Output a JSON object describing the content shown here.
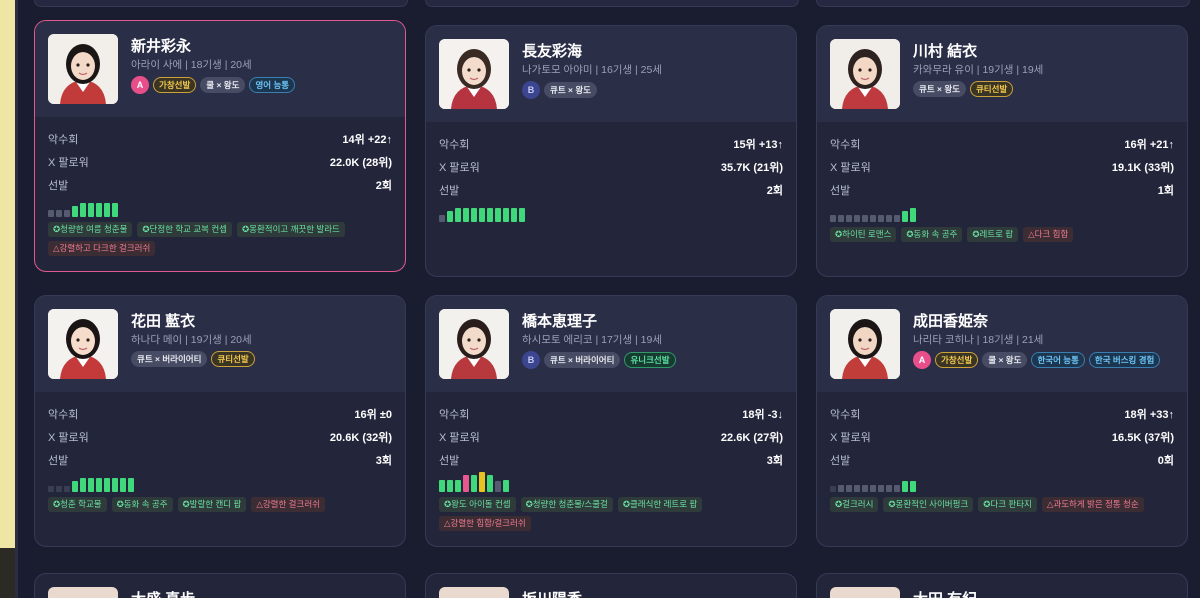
{
  "cards": [
    {
      "name": "新井彩永",
      "sub": "아라이 사에 | 18기생 | 20세",
      "team": "A",
      "tags": [
        {
          "label": "가창선발",
          "style": "gold"
        },
        {
          "label": "쿨 × 왕도",
          "style": "gray"
        },
        {
          "label": "영어 능통",
          "style": "blue"
        }
      ],
      "stats": [
        {
          "label": "악수회",
          "value": "14위 +22↑"
        },
        {
          "label": "X 팔로워",
          "value": "22.0K (28위)"
        },
        {
          "label": "선발",
          "value": "2회"
        }
      ],
      "bars": [
        "#555a70",
        "#555a70",
        "#555a70",
        "#3fd87a",
        "#3fd87a",
        "#3fd87a",
        "#3fd87a",
        "#3fd87a",
        "#3fd87a"
      ],
      "bar_levels": [
        0.35,
        0.35,
        0.35,
        0.55,
        0.7,
        0.7,
        0.7,
        0.7,
        0.7
      ],
      "themes": [
        {
          "label": "✪청량한 여름 청춘물",
          "kind": "good"
        },
        {
          "label": "✪단정한 학교 교복 컨셉",
          "kind": "good"
        },
        {
          "label": "✪몽환적이고 깨끗한 발라드",
          "kind": "good"
        },
        {
          "label": "△강렬하고 다크한 걸크러쉬",
          "kind": "bad"
        }
      ]
    },
    {
      "name": "長友彩海",
      "sub": "나가토모 아야미 | 16기생 | 25세",
      "team": "B",
      "tags": [
        {
          "label": "큐트 × 왕도",
          "style": "gray"
        }
      ],
      "stats": [
        {
          "label": "악수회",
          "value": "15위 +13↑"
        },
        {
          "label": "X 팔로워",
          "value": "35.7K (21위)"
        },
        {
          "label": "선발",
          "value": "2회"
        }
      ],
      "bars": [
        "#555a70",
        "#3fd87a",
        "#3fd87a",
        "#3fd87a",
        "#3fd87a",
        "#3fd87a",
        "#3fd87a",
        "#3fd87a",
        "#3fd87a",
        "#3fd87a",
        "#3fd87a"
      ],
      "bar_levels": [
        0.35,
        0.55,
        0.7,
        0.7,
        0.7,
        0.7,
        0.7,
        0.7,
        0.7,
        0.7,
        0.7
      ],
      "themes": []
    },
    {
      "name": "川村 結衣",
      "sub": "카와무라 유이 | 19기생 | 19세",
      "team": "",
      "tags": [
        {
          "label": "큐트 × 왕도",
          "style": "gray"
        },
        {
          "label": "큐티선발",
          "style": "gold"
        }
      ],
      "stats": [
        {
          "label": "악수회",
          "value": "16위 +21↑"
        },
        {
          "label": "X 팔로워",
          "value": "19.1K (33위)"
        },
        {
          "label": "선발",
          "value": "1회"
        }
      ],
      "bars": [
        "#555a70",
        "#555a70",
        "#555a70",
        "#555a70",
        "#555a70",
        "#555a70",
        "#555a70",
        "#555a70",
        "#555a70",
        "#3fd87a",
        "#3fd87a"
      ],
      "bar_levels": [
        0.35,
        0.35,
        0.35,
        0.35,
        0.35,
        0.35,
        0.35,
        0.35,
        0.35,
        0.55,
        0.7
      ],
      "themes": [
        {
          "label": "✪하이틴 로맨스",
          "kind": "good"
        },
        {
          "label": "✪동화 속 공주",
          "kind": "good"
        },
        {
          "label": "✪레트로 팝",
          "kind": "good"
        },
        {
          "label": "△다크 힙합",
          "kind": "bad"
        }
      ]
    },
    {
      "name": "花田 藍衣",
      "sub": "하나다 메이 | 19기생 | 20세",
      "team": "",
      "tags": [
        {
          "label": "큐트 × 버라이어티",
          "style": "gray"
        },
        {
          "label": "큐티선발",
          "style": "gold"
        }
      ],
      "stats": [
        {
          "label": "악수회",
          "value": "16위 ±0"
        },
        {
          "label": "X 팔로워",
          "value": "20.6K (32위)"
        },
        {
          "label": "선발",
          "value": "3회"
        }
      ],
      "bars": [
        "#3a3e52",
        "#3a3e52",
        "#3a3e52",
        "#3fd87a",
        "#3fd87a",
        "#3fd87a",
        "#3fd87a",
        "#3fd87a",
        "#3fd87a",
        "#3fd87a",
        "#3fd87a"
      ],
      "bar_levels": [
        0.3,
        0.3,
        0.3,
        0.55,
        0.7,
        0.7,
        0.7,
        0.7,
        0.7,
        0.7,
        0.7
      ],
      "themes": [
        {
          "label": "✪청춘 학교물",
          "kind": "good"
        },
        {
          "label": "✪동화 속 공주",
          "kind": "good"
        },
        {
          "label": "✪발랄한 캔디 팝",
          "kind": "good"
        },
        {
          "label": "△강렬한 걸크러쉬",
          "kind": "bad"
        }
      ]
    },
    {
      "name": "橋本恵理子",
      "sub": "하시모토 에리코 | 17기생 | 19세",
      "team": "B",
      "tags": [
        {
          "label": "큐트 × 버라이어티",
          "style": "gray"
        },
        {
          "label": "유니크선발",
          "style": "green"
        }
      ],
      "stats": [
        {
          "label": "악수회",
          "value": "18위 -3↓"
        },
        {
          "label": "X 팔로워",
          "value": "22.6K (27위)"
        },
        {
          "label": "선발",
          "value": "3회"
        }
      ],
      "bars": [
        "#3fd87a",
        "#3fd87a",
        "#3fd87a",
        "#e8578e",
        "#3fd87a",
        "#e8c21f",
        "#3fd87a",
        "#555a70",
        "#3fd87a"
      ],
      "bar_levels": [
        0.6,
        0.6,
        0.6,
        0.85,
        0.85,
        1.0,
        0.85,
        0.55,
        0.6
      ],
      "themes": [
        {
          "label": "✪왕도 아이돌 컨셉",
          "kind": "good"
        },
        {
          "label": "✪청량한 청춘물/스쿨걸",
          "kind": "good"
        },
        {
          "label": "✪클래식한 레트로 팝",
          "kind": "good"
        },
        {
          "label": "△강렬한 힙합/걸크러쉬",
          "kind": "bad"
        }
      ]
    },
    {
      "name": "成田香姫奈",
      "sub": "나리타 코히나 | 18기생 | 21세",
      "team": "A",
      "tags": [
        {
          "label": "가창선발",
          "style": "gold"
        },
        {
          "label": "쿨 × 왕도",
          "style": "gray"
        },
        {
          "label": "한국어 능통",
          "style": "blue"
        },
        {
          "label": "한국 버스킹 경험",
          "style": "blue"
        }
      ],
      "stats": [
        {
          "label": "악수회",
          "value": "18위 +33↑"
        },
        {
          "label": "X 팔로워",
          "value": "16.5K (37위)"
        },
        {
          "label": "선발",
          "value": "0회"
        }
      ],
      "bars": [
        "#3a3e52",
        "#555a70",
        "#555a70",
        "#555a70",
        "#555a70",
        "#555a70",
        "#555a70",
        "#555a70",
        "#555a70",
        "#3fd87a",
        "#3fd87a"
      ],
      "bar_levels": [
        0.3,
        0.35,
        0.35,
        0.35,
        0.35,
        0.35,
        0.35,
        0.35,
        0.35,
        0.55,
        0.55
      ],
      "themes": [
        {
          "label": "✪걸크러시",
          "kind": "good"
        },
        {
          "label": "✪몽환적인 사이버펑크",
          "kind": "good"
        },
        {
          "label": "✪다크 판타지",
          "kind": "good"
        },
        {
          "label": "△과도하게 밝은 정통 청순",
          "kind": "bad"
        }
      ]
    }
  ],
  "bottom_cards": [
    {
      "name": "大盛 真歩"
    },
    {
      "name": "坂川陽香"
    },
    {
      "name": "大田 有紀"
    }
  ],
  "colors": {
    "accent_pink": "#e0598f",
    "good": "#68e0a2",
    "bad": "#f07a90"
  }
}
